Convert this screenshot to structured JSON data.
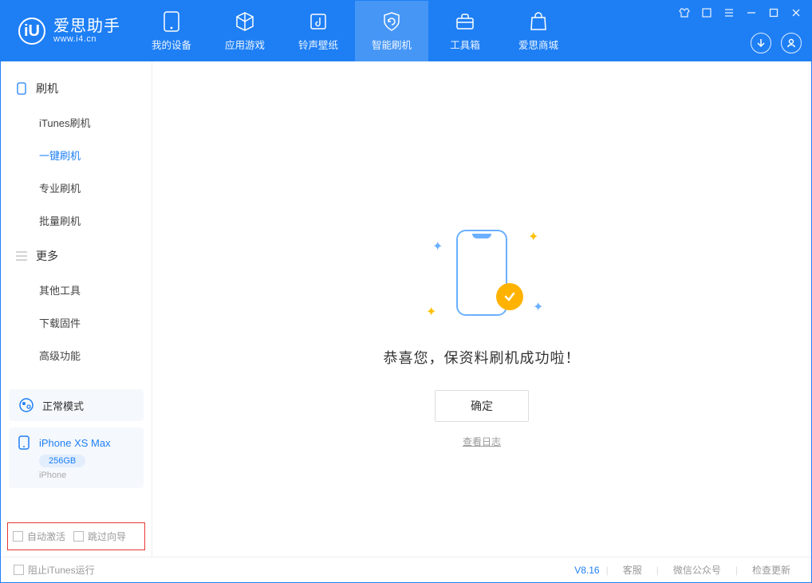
{
  "header": {
    "app_name": "爱思助手",
    "app_url": "www.i4.cn",
    "tabs": [
      {
        "label": "我的设备"
      },
      {
        "label": "应用游戏"
      },
      {
        "label": "铃声壁纸"
      },
      {
        "label": "智能刷机"
      },
      {
        "label": "工具箱"
      },
      {
        "label": "爱思商城"
      }
    ]
  },
  "sidebar": {
    "group1": {
      "title": "刷机",
      "items": [
        "iTunes刷机",
        "一键刷机",
        "专业刷机",
        "批量刷机"
      ]
    },
    "group2": {
      "title": "更多",
      "items": [
        "其他工具",
        "下载固件",
        "高级功能"
      ]
    },
    "mode": "正常模式",
    "device": {
      "name": "iPhone XS Max",
      "capacity": "256GB",
      "type": "iPhone"
    },
    "options": {
      "auto_activate": "自动激活",
      "skip_guide": "跳过向导"
    }
  },
  "main": {
    "success_message": "恭喜您，保资料刷机成功啦！",
    "ok_button": "确定",
    "view_log": "查看日志"
  },
  "footer": {
    "block_itunes": "阻止iTunes运行",
    "version": "V8.16",
    "links": [
      "客服",
      "微信公众号",
      "检查更新"
    ]
  }
}
